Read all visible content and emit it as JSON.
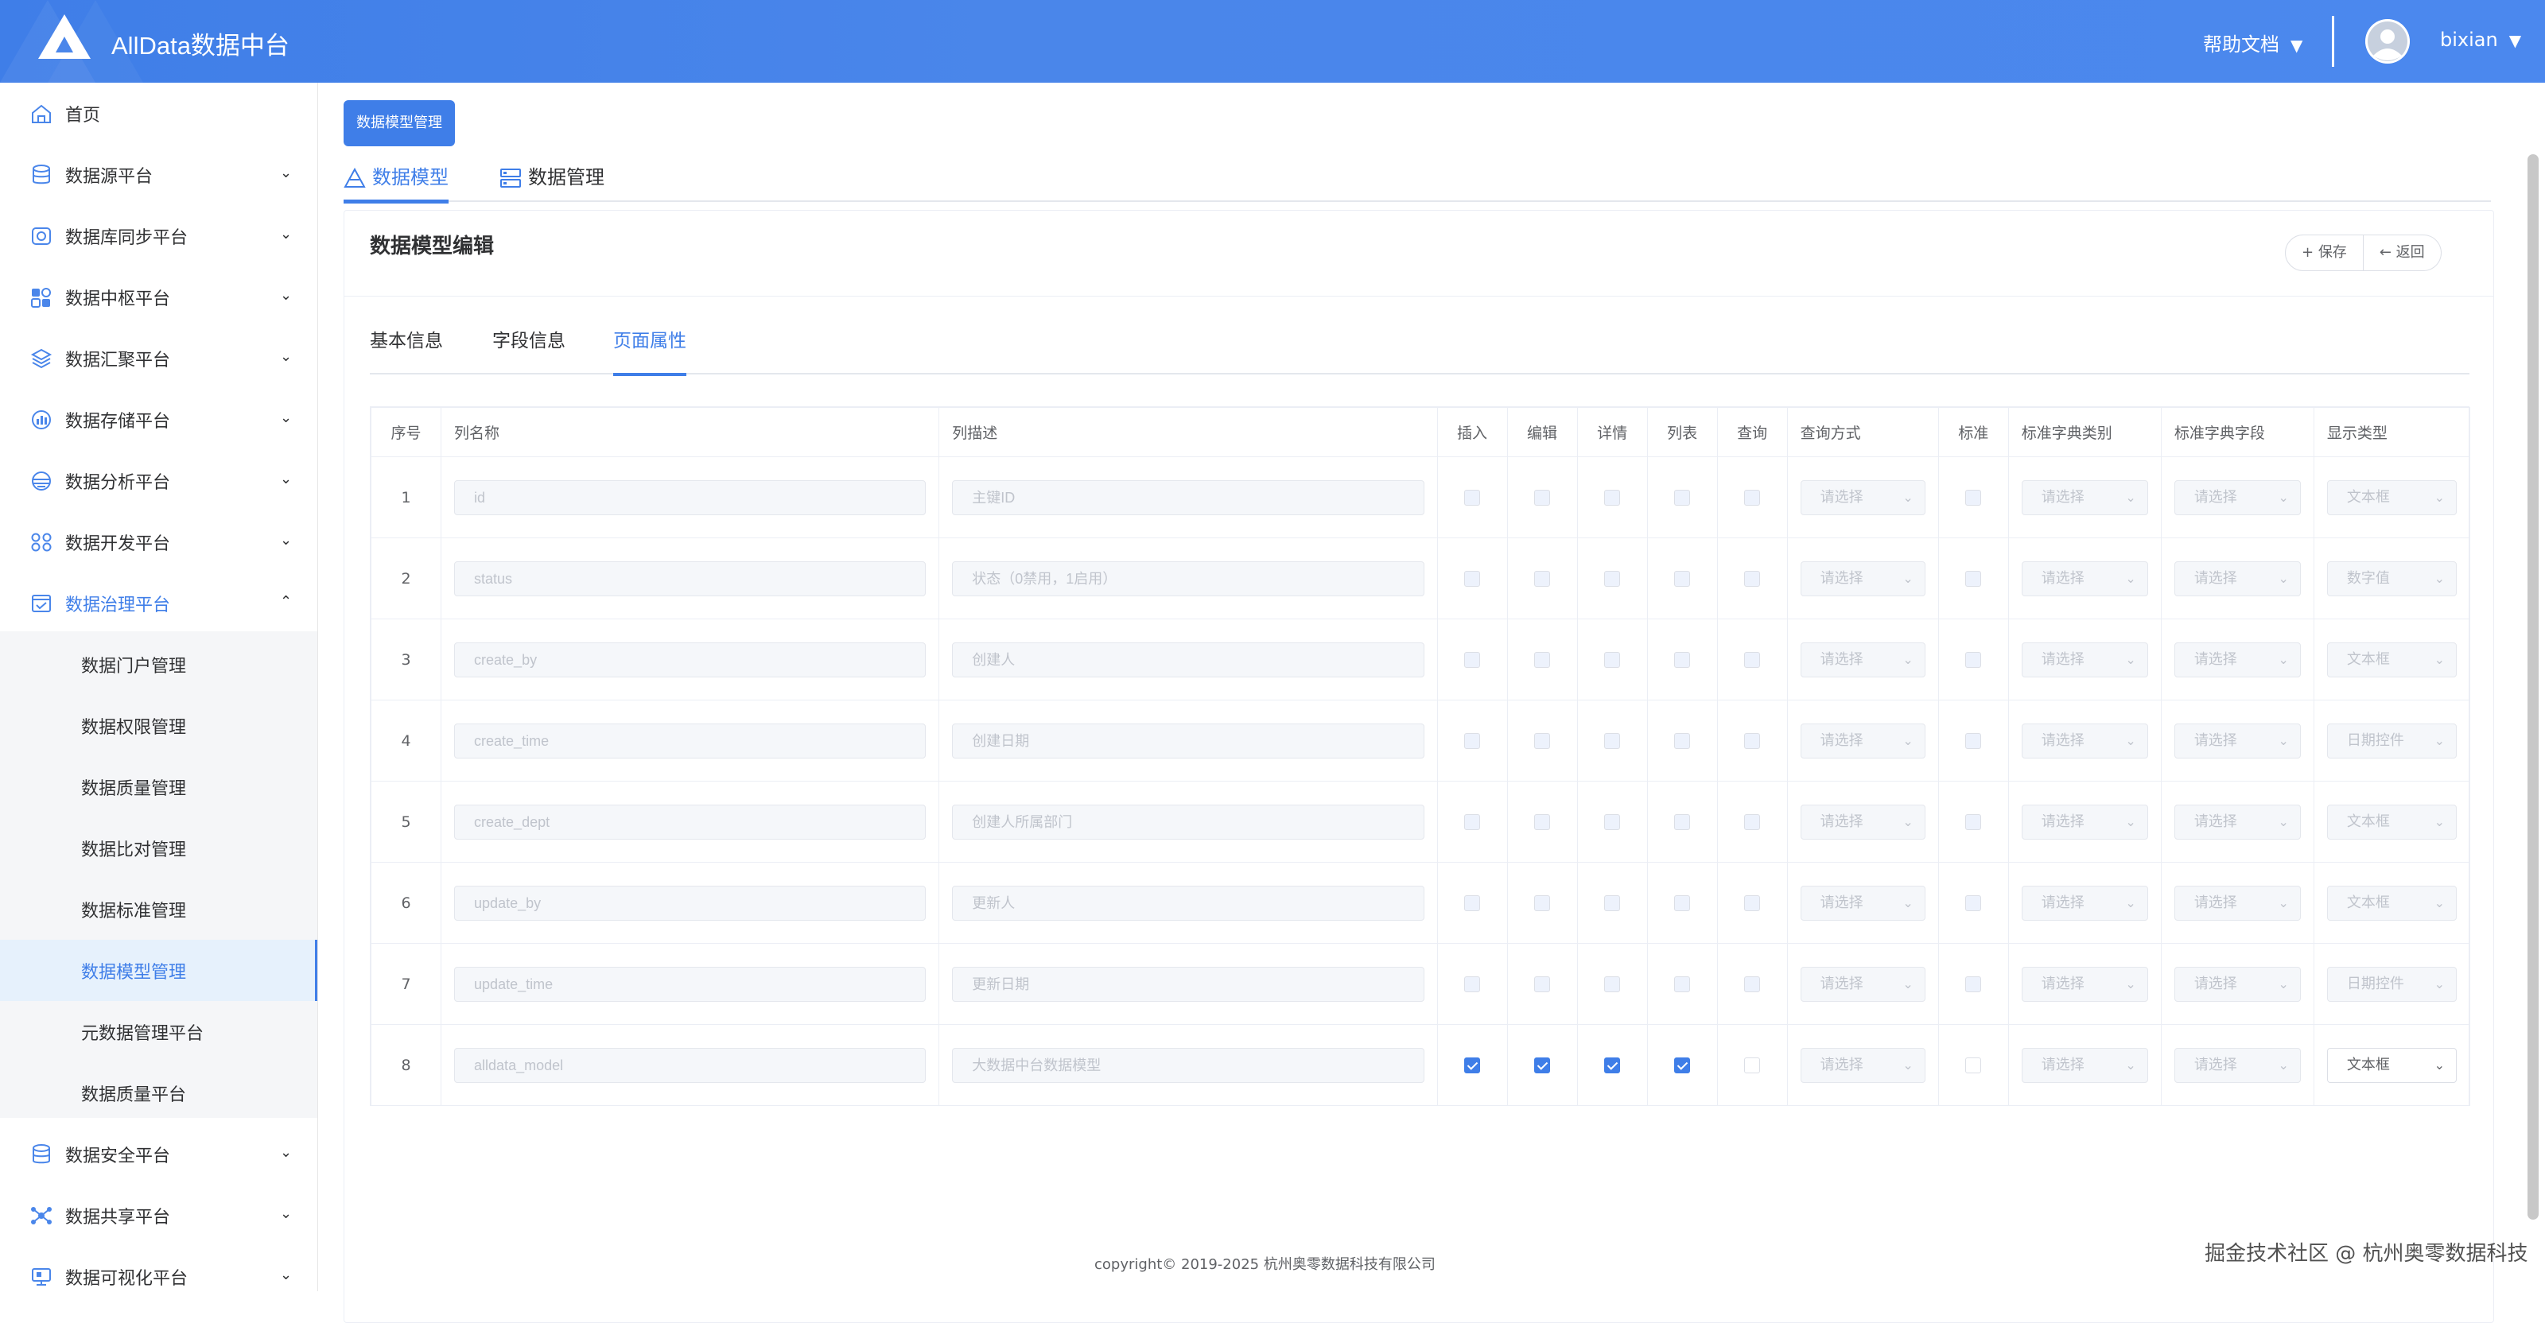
{
  "header": {
    "app_title": "AllData数据中台",
    "help_label": "帮助文档",
    "user_name": "bixian",
    "brand_color": "#4a86ea"
  },
  "sidebar": {
    "items": [
      {
        "label": "首页",
        "icon": "home-icon"
      },
      {
        "label": "数据源平台",
        "icon": "database-icon"
      },
      {
        "label": "数据库同步平台",
        "icon": "sync-icon"
      },
      {
        "label": "数据中枢平台",
        "icon": "apps-icon"
      },
      {
        "label": "数据汇聚平台",
        "icon": "layers-icon"
      },
      {
        "label": "数据存储平台",
        "icon": "storage-icon"
      },
      {
        "label": "数据分析平台",
        "icon": "analysis-icon"
      },
      {
        "label": "数据开发平台",
        "icon": "develop-icon"
      },
      {
        "label": "数据治理平台",
        "icon": "governance-icon"
      },
      {
        "label": "数据安全平台",
        "icon": "security-icon"
      },
      {
        "label": "数据共享平台",
        "icon": "share-icon"
      },
      {
        "label": "数据可视化平台",
        "icon": "monitor-icon"
      }
    ],
    "sub_items": [
      {
        "label": "数据门户管理"
      },
      {
        "label": "数据权限管理"
      },
      {
        "label": "数据质量管理"
      },
      {
        "label": "数据比对管理"
      },
      {
        "label": "数据标准管理"
      },
      {
        "label": "数据模型管理"
      },
      {
        "label": "元数据管理平台"
      },
      {
        "label": "数据质量平台"
      }
    ]
  },
  "breadcrumb": {
    "tag": "数据模型管理"
  },
  "top_tabs": [
    {
      "label": "数据模型",
      "icon": "model-icon"
    },
    {
      "label": "数据管理",
      "icon": "data-manage-icon"
    }
  ],
  "card": {
    "title": "数据模型编辑",
    "save_label": "保存",
    "back_label": "返回",
    "save_icon": "plus-icon",
    "back_icon": "arrow-left-icon"
  },
  "inner_tabs": [
    {
      "label": "基本信息"
    },
    {
      "label": "字段信息"
    },
    {
      "label": "页面属性"
    }
  ],
  "table": {
    "headers": {
      "index": "序号",
      "col_name": "列名称",
      "col_desc": "列描述",
      "insert": "插入",
      "edit": "编辑",
      "detail": "详情",
      "list": "列表",
      "query": "查询",
      "query_mode": "查询方式",
      "standard": "标准",
      "dict_type": "标准字典类别",
      "dict_field": "标准字典字段",
      "display_type": "显示类型"
    },
    "select_placeholder": "请选择",
    "rows": [
      {
        "index": "1",
        "name": "id",
        "desc": "主键ID",
        "display": "文本框",
        "checks": [
          false,
          false,
          false,
          false,
          false
        ],
        "standard": false
      },
      {
        "index": "2",
        "name": "status",
        "desc": "状态（0禁用，1启用）",
        "display": "数字值",
        "checks": [
          false,
          false,
          false,
          false,
          false
        ],
        "standard": false
      },
      {
        "index": "3",
        "name": "create_by",
        "desc": "创建人",
        "display": "文本框",
        "checks": [
          false,
          false,
          false,
          false,
          false
        ],
        "standard": false
      },
      {
        "index": "4",
        "name": "create_time",
        "desc": "创建日期",
        "display": "日期控件",
        "checks": [
          false,
          false,
          false,
          false,
          false
        ],
        "standard": false
      },
      {
        "index": "5",
        "name": "create_dept",
        "desc": "创建人所属部门",
        "display": "文本框",
        "checks": [
          false,
          false,
          false,
          false,
          false
        ],
        "standard": false
      },
      {
        "index": "6",
        "name": "update_by",
        "desc": "更新人",
        "display": "文本框",
        "checks": [
          false,
          false,
          false,
          false,
          false
        ],
        "standard": false
      },
      {
        "index": "7",
        "name": "update_time",
        "desc": "更新日期",
        "display": "日期控件",
        "checks": [
          false,
          false,
          false,
          false,
          false
        ],
        "standard": false
      },
      {
        "index": "8",
        "name": "alldata_model",
        "desc": "大数据中台数据模型",
        "display": "文本框",
        "checks": [
          true,
          true,
          true,
          true,
          false
        ],
        "standard": false
      }
    ]
  },
  "footer": {
    "copyright": "copyright© 2019-2025 杭州奥零数据科技有限公司"
  },
  "watermark": {
    "text": "掘金技术社区 @ 杭州奥零数据科技"
  }
}
